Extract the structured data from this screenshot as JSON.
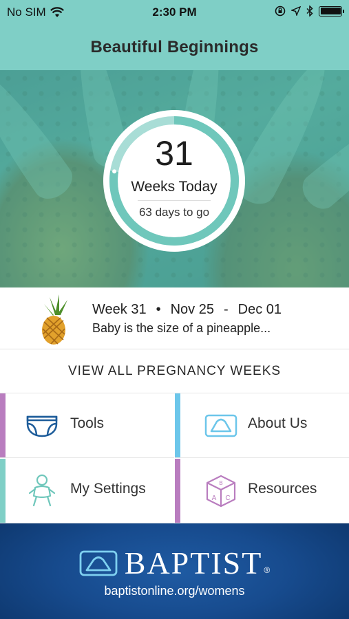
{
  "status_bar": {
    "carrier": "No SIM",
    "time": "2:30 PM"
  },
  "nav": {
    "title": "Beautiful Beginnings"
  },
  "progress": {
    "weeks_number": "31",
    "weeks_label": "Weeks Today",
    "days_to_go": "63 days to go",
    "fraction_complete": 0.775
  },
  "week_info": {
    "week": "Week 31",
    "bullet": "•",
    "start": "Nov 25",
    "dash": "-",
    "end": "Dec 01",
    "size_text": "Baby is the size of a pineapple..."
  },
  "view_all": {
    "label": "VIEW ALL PREGNANCY WEEKS"
  },
  "tiles": [
    {
      "label": "Tools",
      "icon": "diaper-icon",
      "accent": "#b97dbf"
    },
    {
      "label": "About Us",
      "icon": "baptist-logo-icon",
      "accent": "#6cc6ea"
    },
    {
      "label": "My Settings",
      "icon": "baby-icon",
      "accent": "#7fcfc6"
    },
    {
      "label": "Resources",
      "icon": "abc-block-icon",
      "accent": "#b97dbf"
    }
  ],
  "footer": {
    "brand": "BAPTIST",
    "registered": "®",
    "url": "baptistonline.org/womens"
  },
  "colors": {
    "teal": "#7fcfc6",
    "ring_teal": "#6fc7bb",
    "ring_light": "#a8ddd6",
    "purple": "#b97dbf",
    "blue": "#6cc6ea",
    "footer_blue": "#174b8e"
  }
}
